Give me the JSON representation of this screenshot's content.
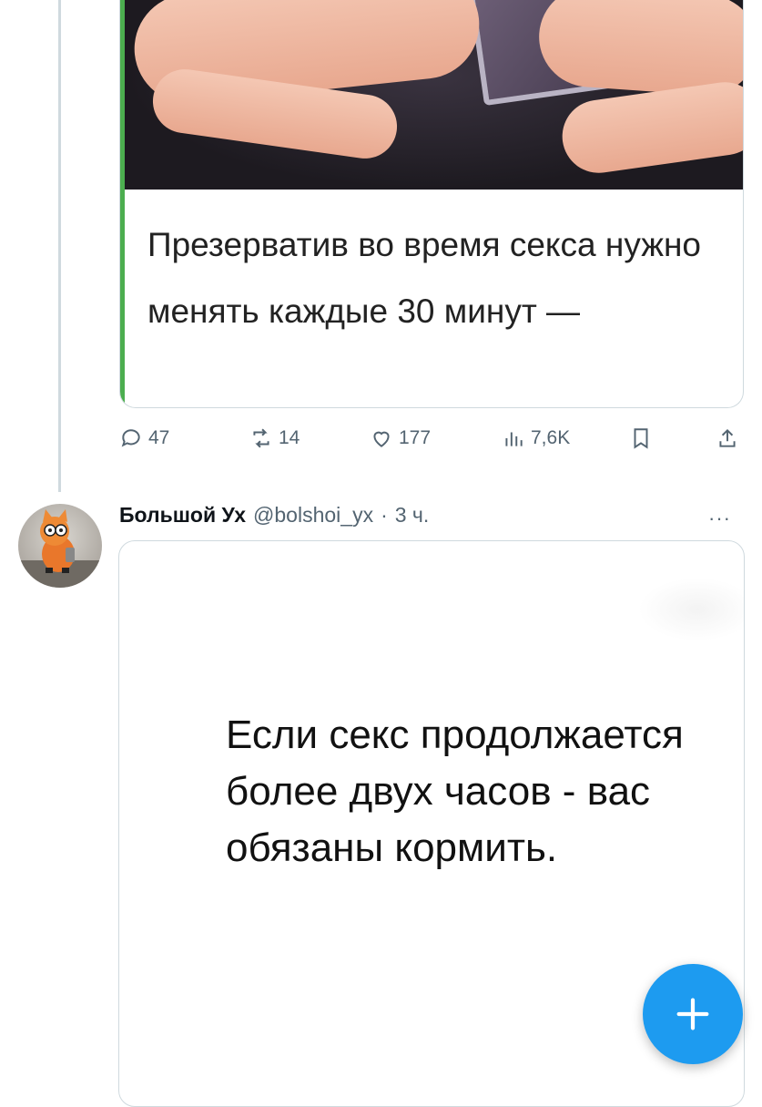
{
  "quoted_card": {
    "headline": "Презерватив во время секса нужно менять каждые 30 минут —",
    "accent_color": "#4cae4f"
  },
  "actions": {
    "replies": "47",
    "reposts": "14",
    "likes": "177",
    "views": "7,6K",
    "icons": [
      "reply-icon",
      "repost-icon",
      "like-icon",
      "views-icon",
      "bookmark-icon",
      "share-icon"
    ]
  },
  "tweet": {
    "author_name": "Большой Ух",
    "handle": "@bolshoi_yx",
    "separator": "·",
    "time": "3 ч.",
    "more_label": "···",
    "image_text": "Если секс продолжается более двух часов - вас обязаны кормить."
  },
  "colors": {
    "accent": "#1d9bf0",
    "muted": "#536471",
    "border": "#cfd9de"
  }
}
